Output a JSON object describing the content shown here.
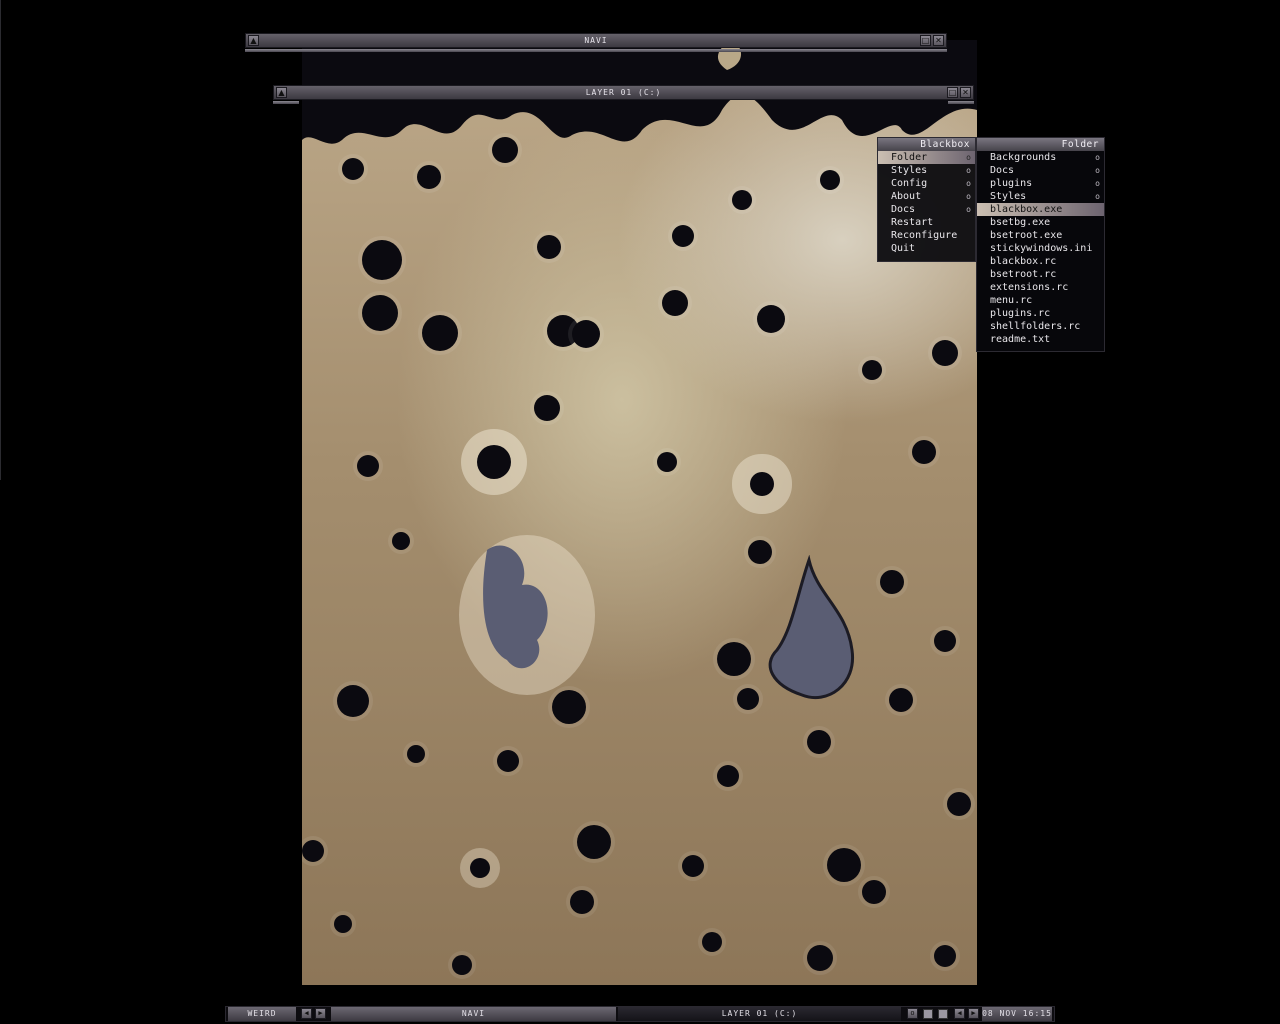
{
  "windows": {
    "navi": {
      "title": "NAVI"
    },
    "layer": {
      "title": "LAYER 01 (C:)"
    }
  },
  "menus": {
    "blackbox": {
      "title": "Blackbox",
      "items": [
        {
          "label": "Folder",
          "submenu": "o"
        },
        {
          "label": "Styles",
          "submenu": "o"
        },
        {
          "label": "Config",
          "submenu": "o"
        },
        {
          "label": "About",
          "submenu": "o"
        },
        {
          "label": "Docs",
          "submenu": "o"
        },
        {
          "label": "Restart"
        },
        {
          "label": "Reconfigure"
        },
        {
          "label": "Quit"
        }
      ]
    },
    "folder": {
      "title": "Folder",
      "items": [
        {
          "label": "Backgrounds",
          "submenu": "o"
        },
        {
          "label": "Docs",
          "submenu": "o"
        },
        {
          "label": "plugins",
          "submenu": "o"
        },
        {
          "label": "Styles",
          "submenu": "o"
        },
        {
          "label": "blackbox.exe"
        },
        {
          "label": "bsetbg.exe"
        },
        {
          "label": "bsetroot.exe"
        },
        {
          "label": "stickywindows.ini"
        },
        {
          "label": "blackbox.rc"
        },
        {
          "label": "bsetroot.rc"
        },
        {
          "label": "extensions.rc"
        },
        {
          "label": "menu.rc"
        },
        {
          "label": "plugins.rc"
        },
        {
          "label": "shellfolders.rc"
        },
        {
          "label": "readme.txt"
        }
      ]
    }
  },
  "taskbar": {
    "workspace": "WEIRD",
    "task1": "NAVI",
    "task2": "LAYER 01 (C:)",
    "clock": "08 NOV 16:15"
  },
  "icons": {
    "left_arrow": "◀",
    "right_arrow": "▶",
    "shade": "▲",
    "maximize": "□",
    "close": "✕"
  },
  "colors": {
    "menu_bg": "#08080c",
    "highlight": "#cbbfb2",
    "titlebar": "#65616a"
  }
}
